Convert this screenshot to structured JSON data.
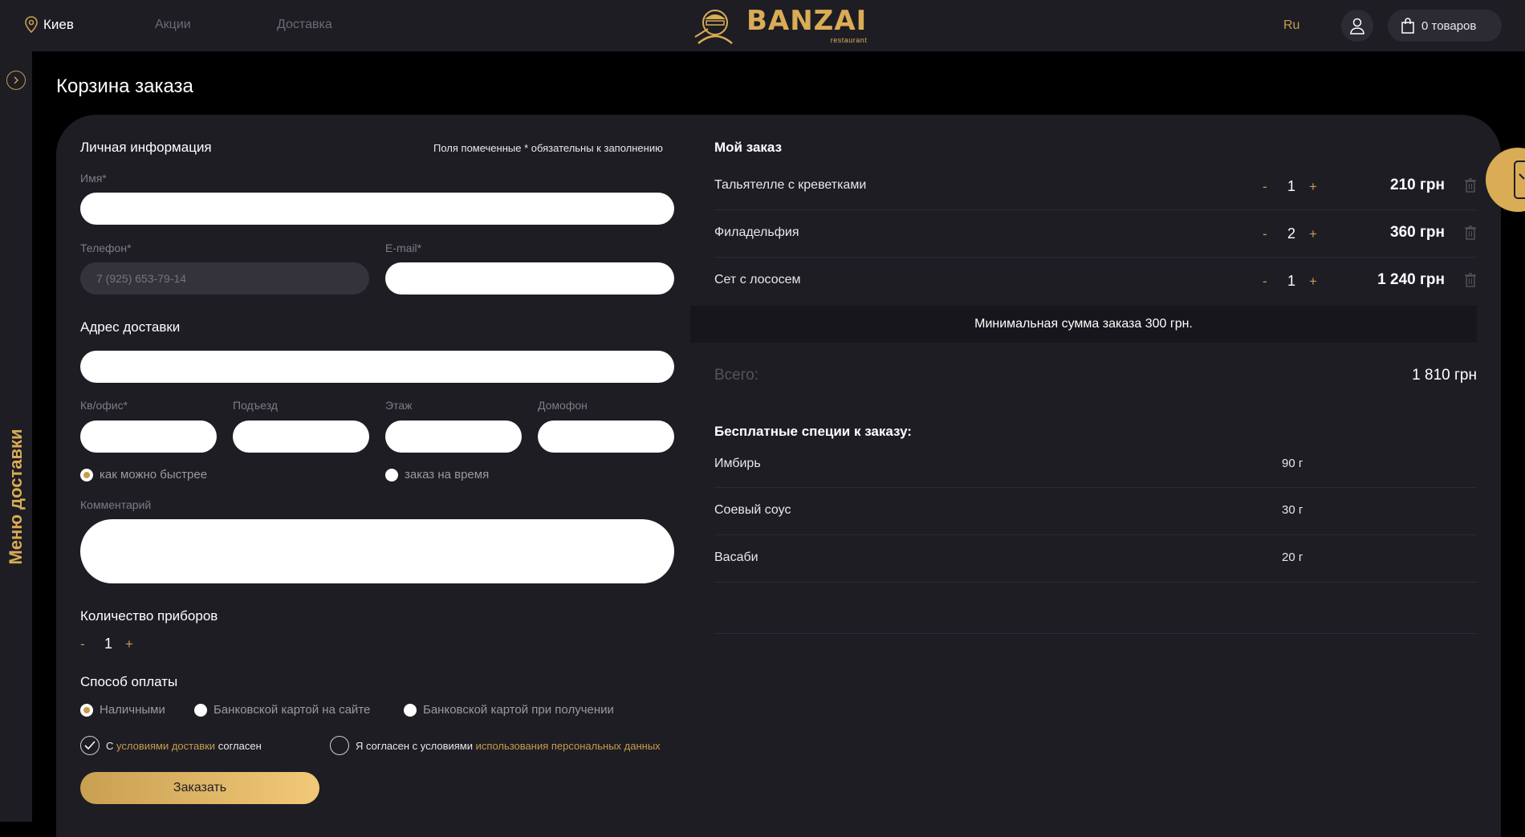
{
  "header": {
    "city": "Киев",
    "nav": [
      "Акции",
      "Доставка"
    ],
    "logo_text": "BANZAI",
    "logo_sub": "restaurant",
    "lang": "Ru",
    "cart_label": "0 товаров"
  },
  "sidebar": {
    "label": "Меню доставки"
  },
  "page_title": "Корзина заказа",
  "form": {
    "personal_title": "Личная информация",
    "required_hint": "Поля помеченные * обязательны к заполнению",
    "name_label": "Имя*",
    "phone_label": "Телефон*",
    "phone_placeholder": "7 (925) 653-79-14",
    "email_label": "E-mail*",
    "address_title": "Адрес доставки",
    "apt_label": "Кв/офис*",
    "entrance_label": "Подъезд",
    "floor_label": "Этаж",
    "intercom_label": "Домофон",
    "time_options": [
      "как можно быстрее",
      "заказ на время"
    ],
    "comment_label": "Комментарий",
    "cutlery_title": "Количество приборов",
    "cutlery_count": "1",
    "payment_title": "Способ оплаты",
    "payment_options": [
      "Наличными",
      "Банковской картой на сайте",
      "Банковской картой при получении"
    ],
    "agree1_pre": "С",
    "agree1_link": "условиями доставки",
    "agree1_post": "согласен",
    "agree2_pre": "Я согласен с условиями",
    "agree2_link": "использования персональных данных",
    "submit_label": "Заказать",
    "minus": "-",
    "plus": "+"
  },
  "order": {
    "title": "Мой заказ",
    "items": [
      {
        "name": "Тальятелле с креветками",
        "qty": "1",
        "price": "210 грн"
      },
      {
        "name": "Филадельфия",
        "qty": "2",
        "price": "360 грн"
      },
      {
        "name": "Сет с лососем",
        "qty": "1",
        "price": "1 240 грн"
      }
    ],
    "min_sum": "Минимальная сумма заказа 300 грн.",
    "total_label": "Всего:",
    "total_value": "1 810 грн",
    "spices_title": "Бесплатные специи к заказу:",
    "spices": [
      {
        "name": "Имбирь",
        "weight": "90 г"
      },
      {
        "name": "Соевый соус",
        "weight": "30 г"
      },
      {
        "name": "Васаби",
        "weight": "20 г"
      }
    ]
  },
  "colors": {
    "accent": "#c79b4c",
    "bg": "#000000",
    "panel": "#1e1d24"
  }
}
